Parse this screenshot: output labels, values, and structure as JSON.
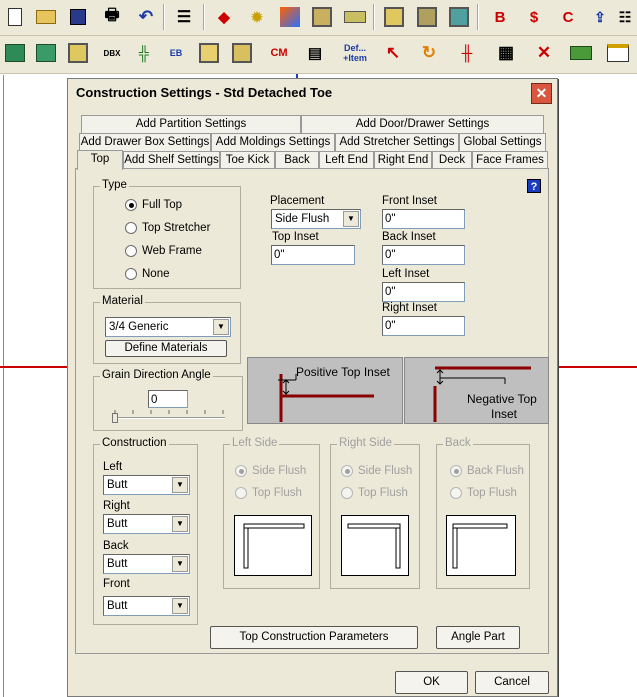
{
  "dialog": {
    "title": "Construction Settings - Std Detached Toe"
  },
  "tabs": {
    "row1": [
      "Add Partition Settings",
      "Add Door/Drawer Settings"
    ],
    "row2": [
      "Add Drawer Box Settings",
      "Add Moldings Settings",
      "Add Stretcher Settings",
      "Global Settings"
    ],
    "row3": [
      "Top",
      "Add Shelf Settings",
      "Toe Kick",
      "Back",
      "Left End",
      "Right End",
      "Deck",
      "Face Frames"
    ]
  },
  "type_group": {
    "label": "Type",
    "options": [
      "Full Top",
      "Top Stretcher",
      "Web Frame",
      "None"
    ],
    "selected": "Full Top"
  },
  "placement": {
    "label": "Placement",
    "value": "Side Flush"
  },
  "top_inset": {
    "label": "Top Inset",
    "value": "0\""
  },
  "front_inset": {
    "label": "Front Inset",
    "value": "0\""
  },
  "back_inset": {
    "label": "Back Inset",
    "value": "0\""
  },
  "left_inset": {
    "label": "Left Inset",
    "value": "0\""
  },
  "right_inset": {
    "label": "Right Inset",
    "value": "0\""
  },
  "material": {
    "label": "Material",
    "value": "3/4 Generic",
    "define_button": "Define Materials"
  },
  "grain": {
    "label": "Grain Direction Angle",
    "value": "0"
  },
  "diagrams": {
    "positive": "Positive Top Inset",
    "negative_line1": "Negative Top",
    "negative_line2": "Inset"
  },
  "construction": {
    "label": "Construction",
    "left_label": "Left",
    "left_value": "Butt",
    "right_label": "Right",
    "right_value": "Butt",
    "back_label": "Back",
    "back_value": "Butt",
    "front_label": "Front",
    "front_value": "Butt"
  },
  "left_side": {
    "label": "Left Side",
    "opt1": "Side Flush",
    "opt2": "Top Flush"
  },
  "right_side": {
    "label": "Right Side",
    "opt1": "Side Flush",
    "opt2": "Top Flush"
  },
  "back_side": {
    "label": "Back",
    "opt1": "Back Flush",
    "opt2": "Top Flush"
  },
  "buttons": {
    "top_params": "Top Construction Parameters",
    "angle_part": "Angle Part",
    "ok": "OK",
    "cancel": "Cancel"
  },
  "help_glyph": "?",
  "close_glyph": "✕",
  "toolbar_glyphs": {
    "b": "B",
    "dollar": "$",
    "c": "C",
    "x": "✕",
    "def1": "Def...",
    "def2": "+Item",
    "dbx": "DBX",
    "eb": "EB",
    "cm": "CM"
  },
  "colors": {
    "accent_red": "#c00000",
    "dialog_bg": "#ece9d8",
    "help_blue": "#1a3ac0"
  }
}
